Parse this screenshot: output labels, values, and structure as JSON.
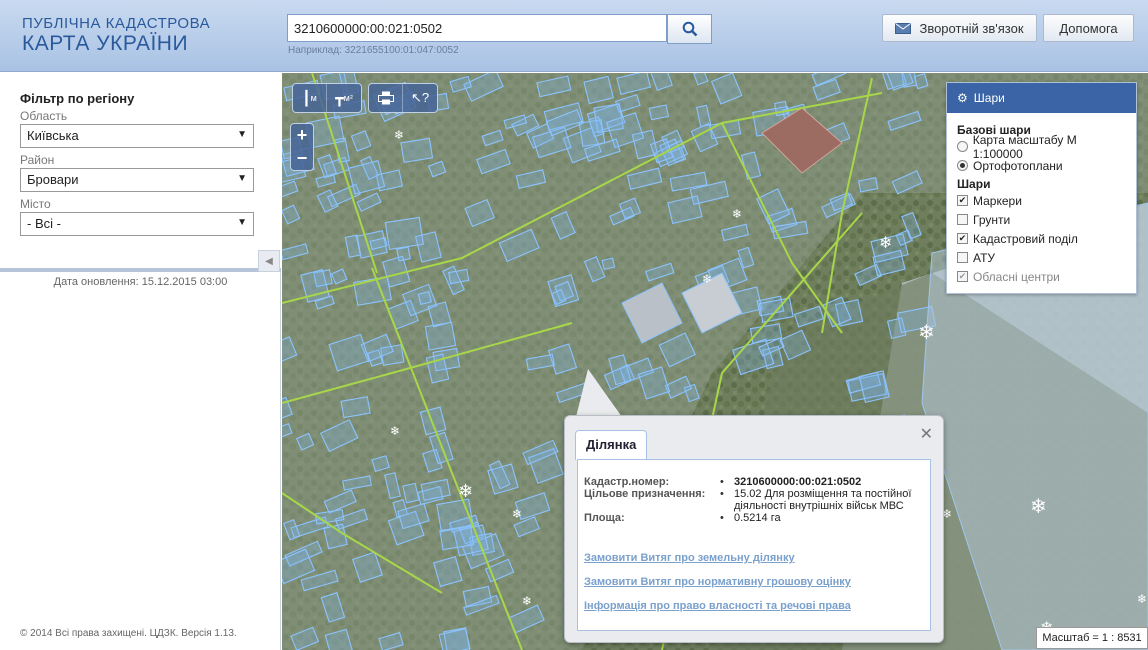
{
  "header": {
    "title_line1": "ПУБЛІЧНА КАДАСТРОВА",
    "title_line2": "КАРТА УКРАЇНИ",
    "search_value": "3210600000:00:021:0502",
    "search_hint": "Наприклад: 3221655100:01:047:0052",
    "feedback_label": "Зворотній зв'язок",
    "help_label": "Допомога"
  },
  "filter": {
    "title": "Фільтр по регіону",
    "region_label": "Область",
    "region_value": "Київська",
    "district_label": "Район",
    "district_value": "Бровари",
    "city_label": "Місто",
    "city_value": "- Всі -"
  },
  "sidebar": {
    "updated": "Дата оновлення: 15.12.2015 03:00",
    "copyright": "© 2014 Всі права захищені. ЦДЗК. Версія 1.13."
  },
  "toolbar": {
    "measure_length_label": "м",
    "measure_area_label": "м²"
  },
  "layers": {
    "title": "Шари",
    "base_title": "Базові шари",
    "base": [
      {
        "label": "Карта масштабу М 1:100000",
        "selected": false
      },
      {
        "label": "Ортофотоплани",
        "selected": true
      }
    ],
    "overlay_title": "Шари",
    "overlays": [
      {
        "label": "Маркери",
        "checked": true
      },
      {
        "label": "Грунти",
        "checked": false
      },
      {
        "label": "Кадастровий поділ",
        "checked": true
      },
      {
        "label": "АТУ",
        "checked": false
      },
      {
        "label": "Обласні центри",
        "checked": true
      }
    ]
  },
  "popup": {
    "tab": "Ділянка",
    "rows": [
      {
        "key": "Кадастр.номер:",
        "value": "3210600000:00:021:0502"
      },
      {
        "key": "Цільове призначення:",
        "value": "15.02 Для розміщення та постійної діяльності внутрішніх військ МВС"
      },
      {
        "key": "Площа:",
        "value": "0.5214 га"
      }
    ],
    "links": [
      "Замовити Витяг про земельну ділянку",
      "Замовити Витяг про нормативну грошову оцінку",
      "Інформація про право власності та речові права"
    ]
  },
  "scale": "Масштаб = 1 : 8531",
  "colors": {
    "header_bg": "#b9cfeb",
    "accent": "#2a5a9c",
    "parcel": "#7fb6f0",
    "road": "#a8d64a",
    "link": "#7aa0cc"
  }
}
